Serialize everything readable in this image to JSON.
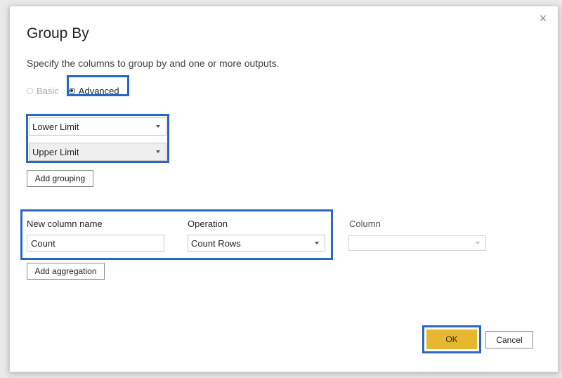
{
  "dialog": {
    "title": "Group By",
    "subtitle": "Specify the columns to group by and one or more outputs.",
    "close_glyph": "×"
  },
  "mode": {
    "basic_label": "Basic",
    "advanced_label": "Advanced",
    "selected": "advanced"
  },
  "grouping": {
    "columns": [
      "Lower Limit",
      "Upper Limit"
    ],
    "add_label": "Add grouping"
  },
  "aggregation": {
    "new_column_label": "New column name",
    "new_column_value": "Count",
    "operation_label": "Operation",
    "operation_value": "Count Rows",
    "column_label": "Column",
    "column_value": "",
    "add_label": "Add aggregation"
  },
  "footer": {
    "ok_label": "OK",
    "cancel_label": "Cancel"
  },
  "colors": {
    "highlight": "#2a67c4",
    "ok_button": "#e8b730"
  },
  "icons": {
    "close": "close-icon",
    "dropdown": "chevron-down-icon"
  }
}
